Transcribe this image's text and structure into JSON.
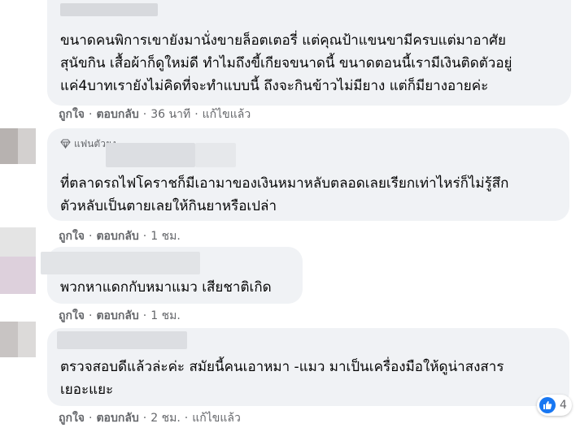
{
  "comments": [
    {
      "lines": [
        "ขนาดคนพิการเขายังมานั่งขายล็อตเตอรี่ แต่คุณป้าแขนขามีครบแต่มาอาศัย",
        "สุนัขกิน เสื้อผ้าก็ดูใหม่ดี ทำไมถึงขี้เกียจขนาดนี้ ขนาดตอนนี้เรามีเงินติดตัวอยู่",
        "แค่4บาทเรายังไม่คิดที่จะทำแบบนี้ ถึงจะกินข้าวไม่มียาง แต่ก็มียางอายค่ะ"
      ],
      "like": "ถูกใจ",
      "reply": "ตอบกลับ",
      "time": "36 นาที",
      "edited": "แก้ไขแล้ว"
    },
    {
      "badge": "แฟนตัวยง",
      "lines": [
        "ที่ตลาดรถไฟโคราชก็มีเอามาของเงินหมาหลับตลอดเลยเรียกเท่าไหร่ก็ไม่รู้สึก",
        "ตัวหลับเป็นตายเลยให้กินยาหรือเปล่า"
      ],
      "like": "ถูกใจ",
      "reply": "ตอบกลับ",
      "time": "1 ชม."
    },
    {
      "lines": [
        "พวกหาแดกกับหมาแมว เสียชาติเกิด"
      ],
      "like": "ถูกใจ",
      "reply": "ตอบกลับ",
      "time": "1 ชม."
    },
    {
      "lines": [
        "ตรวจสอบดีแล้วล่ะค่ะ สมัยนี้คนเอาหมา -แมว มาเป็นเครื่องมือให้ดูน่าสงสาร",
        "เยอะแยะ"
      ],
      "like": "ถูกใจ",
      "reply": "ตอบกลับ",
      "time": "2 ชม.",
      "edited": "แก้ไขแล้ว"
    }
  ],
  "reaction": {
    "icon": "like-icon",
    "count": "4",
    "color": "#1877f2"
  }
}
